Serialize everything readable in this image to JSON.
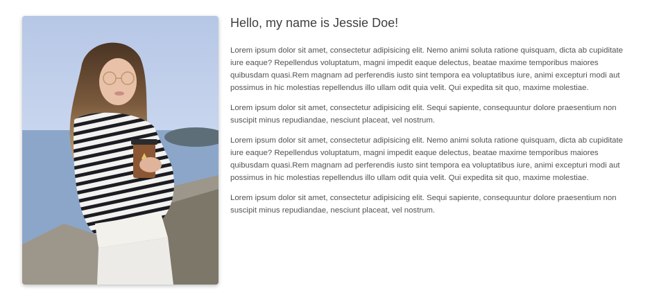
{
  "profile": {
    "heading": "Hello, my name is Jessie Doe!",
    "paragraphs": [
      "Lorem ipsum dolor sit amet, consectetur adipisicing elit. Nemo animi soluta ratione quisquam, dicta ab cupiditate iure eaque? Repellendus voluptatum, magni impedit eaque delectus, beatae maxime temporibus maiores quibusdam quasi.Rem magnam ad perferendis iusto sint tempora ea voluptatibus iure, animi excepturi modi aut possimus in hic molestias repellendus illo ullam odit quia velit. Qui expedita sit quo, maxime molestiae.",
      "Lorem ipsum dolor sit amet, consectetur adipisicing elit. Sequi sapiente, consequuntur dolore praesentium non suscipit minus repudiandae, nesciunt placeat, vel nostrum.",
      "Lorem ipsum dolor sit amet, consectetur adipisicing elit. Nemo animi soluta ratione quisquam, dicta ab cupiditate iure eaque? Repellendus voluptatum, magni impedit eaque delectus, beatae maxime temporibus maiores quibusdam quasi.Rem magnam ad perferendis iusto sint tempora ea voluptatibus iure, animi excepturi modi aut possimus in hic molestias repellendus illo ullam odit quia velit. Qui expedita sit quo, maxime molestiae.",
      "Lorem ipsum dolor sit amet, consectetur adipisicing elit. Sequi sapiente, consequuntur dolore praesentium non suscipit minus repudiandae, nesciunt placeat, vel nostrum."
    ]
  },
  "colors": {
    "heading": "#3f3f3f",
    "body_text": "#525252",
    "background": "#ffffff"
  },
  "photo": {
    "icon": "profile-photo"
  }
}
